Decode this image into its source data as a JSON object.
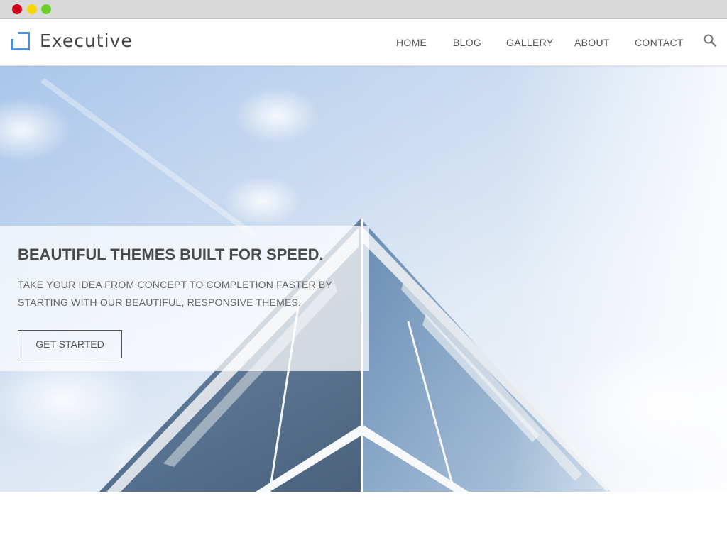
{
  "brand": {
    "name": "Executive",
    "accent": "#4a90d9"
  },
  "nav": {
    "items": [
      {
        "label": "HOME"
      },
      {
        "label": "BLOG"
      },
      {
        "label": "GALLERY"
      },
      {
        "label": "ABOUT"
      },
      {
        "label": "CONTACT"
      }
    ],
    "search_icon": "search-icon"
  },
  "hero": {
    "title": "BEAUTIFUL THEMES BUILT FOR SPEED.",
    "subtitle": "TAKE YOUR IDEA FROM CONCEPT TO COMPLETION FASTER BY STARTING WITH OUR BEAUTIFUL, RESPONSIVE THEMES.",
    "cta_label": "GET STARTED"
  },
  "colors": {
    "window_close": "#d0021b",
    "window_minimize": "#f5d800",
    "window_zoom": "#6dd02b",
    "text_dark": "#4a4a4a",
    "text_muted": "#666666"
  }
}
